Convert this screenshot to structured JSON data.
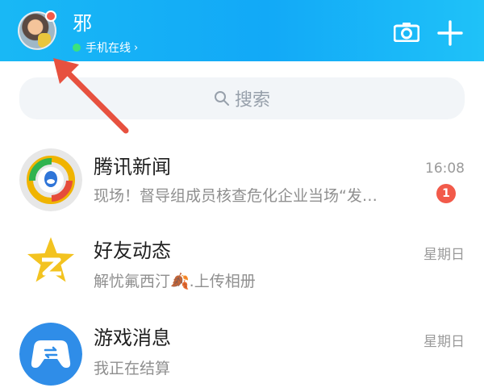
{
  "header": {
    "username": "邪",
    "status_text": "手机在线",
    "status_chevron": "›"
  },
  "search": {
    "label": "搜索"
  },
  "conversations": [
    {
      "title": "腾讯新闻",
      "preview": "现场！督导组成员核查危化企业当场“发…",
      "time": "16:08",
      "badge": "1",
      "icon": "tencent-news-icon"
    },
    {
      "title": "好友动态",
      "preview": "解忧氟西汀🍂.上传相册",
      "time": "星期日",
      "icon": "qzone-star-icon"
    },
    {
      "title": "游戏消息",
      "preview": "我正在结算",
      "time": "星期日",
      "icon": "game-controller-icon"
    }
  ],
  "colors": {
    "topbar": "#12a9f7",
    "badge": "#f25a4a",
    "arrow": "#e7513f"
  }
}
